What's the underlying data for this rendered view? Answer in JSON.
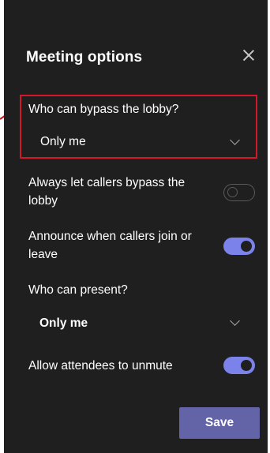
{
  "panel": {
    "title": "Meeting options",
    "close_icon": "close-icon"
  },
  "options": {
    "bypass_lobby": {
      "label": "Who can bypass the lobby?",
      "value": "Only me"
    },
    "callers_bypass": {
      "label_line1": "Always let callers bypass the",
      "label_line2": "lobby",
      "enabled": false
    },
    "announce_callers": {
      "label_line1": "Announce when callers join or",
      "label_line2": "leave",
      "enabled": true
    },
    "who_can_present": {
      "label": "Who can present?",
      "value": "Only me"
    },
    "attendees_unmute": {
      "label": "Allow attendees to unmute",
      "enabled": true
    }
  },
  "actions": {
    "save_label": "Save"
  },
  "colors": {
    "background": "#1f1f1f",
    "accent": "#7b83eb",
    "button": "#6264a7",
    "highlight": "#d6172a"
  }
}
